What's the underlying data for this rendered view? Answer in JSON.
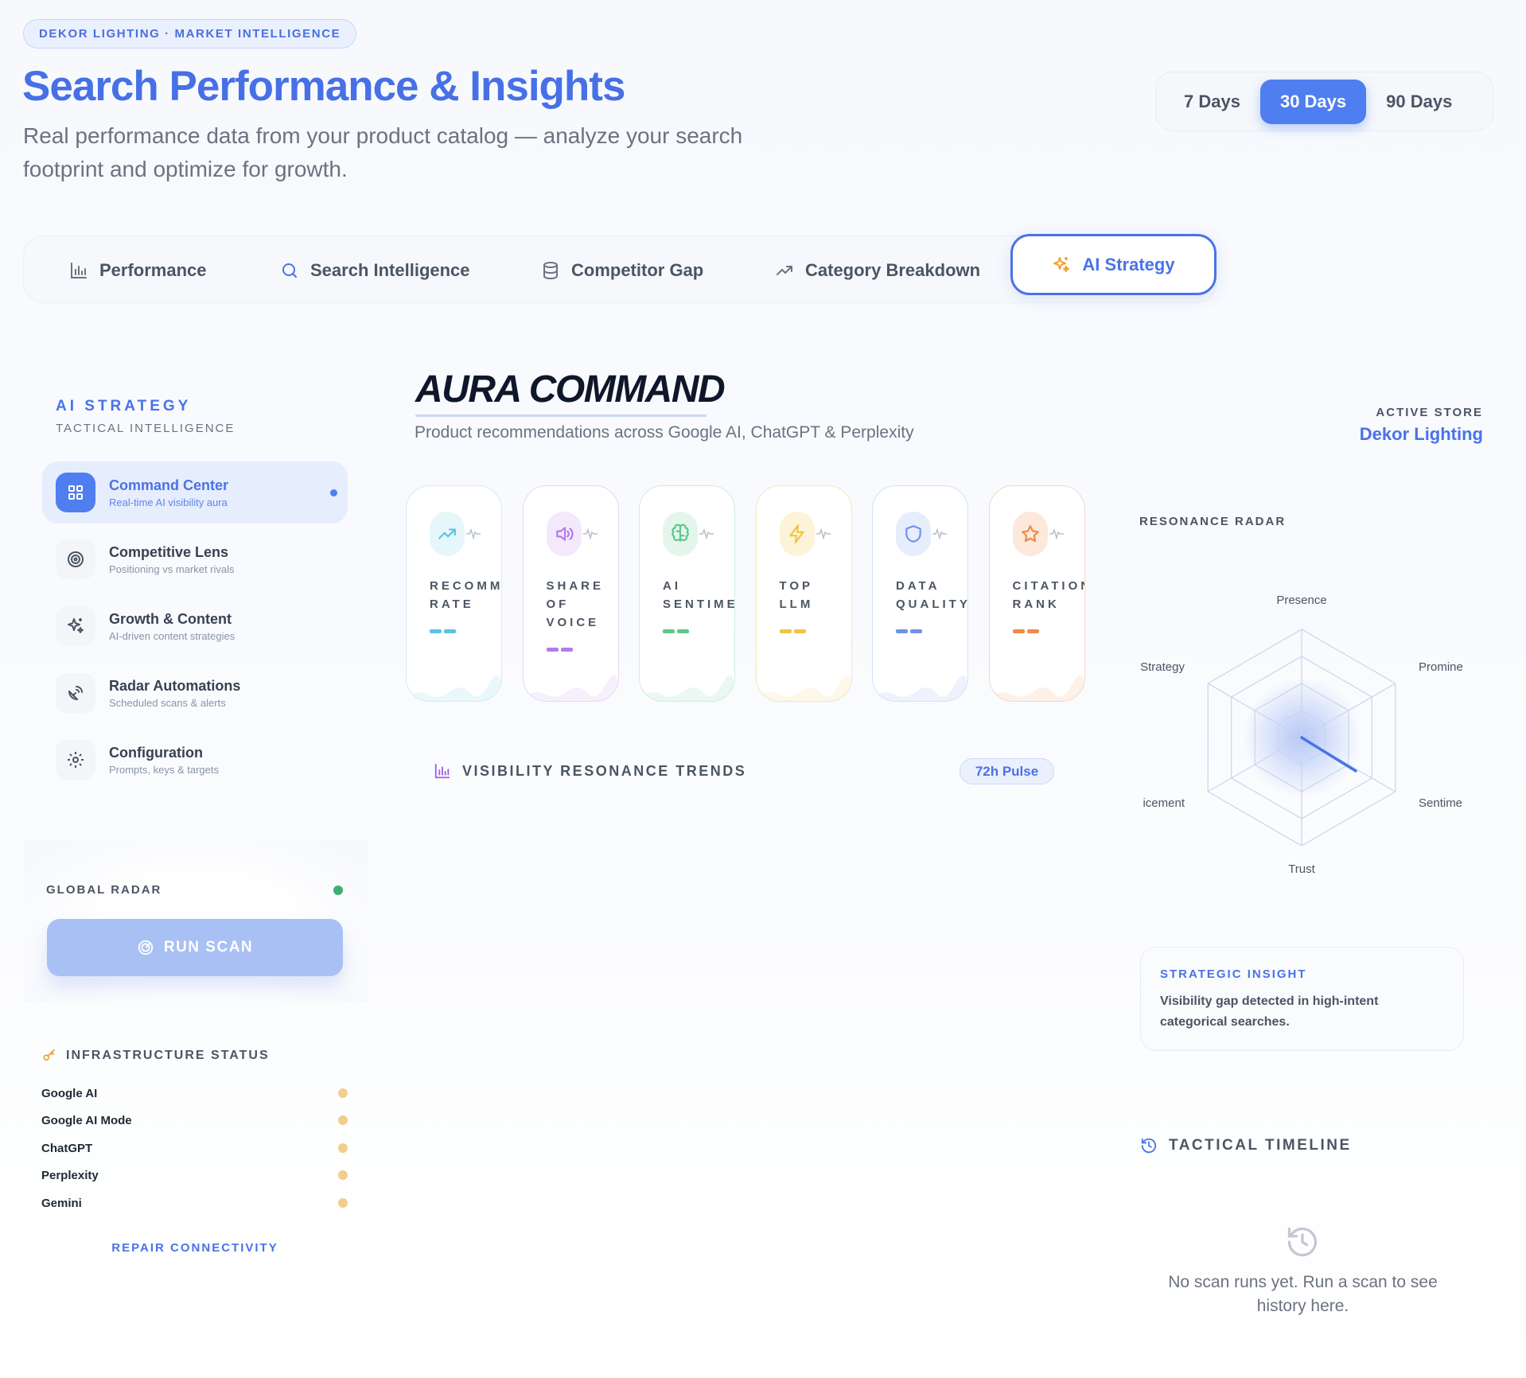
{
  "header": {
    "tag": "DEKOR LIGHTING · MARKET INTELLIGENCE",
    "title": "Search Performance & Insights",
    "subtitle": "Real performance data from your product catalog — analyze your search footprint and optimize for growth."
  },
  "date_range": {
    "options": [
      "7 Days",
      "30 Days",
      "90 Days"
    ],
    "selected": "30 Days"
  },
  "tabs": [
    {
      "label": "Performance",
      "icon": "bar-chart-icon"
    },
    {
      "label": "Search Intelligence",
      "icon": "search-icon"
    },
    {
      "label": "Competitor Gap",
      "icon": "database-icon"
    },
    {
      "label": "Category Breakdown",
      "icon": "trending-up-icon"
    },
    {
      "label": "AI Strategy",
      "icon": "sparkles-icon",
      "active": true
    }
  ],
  "sidebar": {
    "title": "AI STRATEGY",
    "subtitle": "TACTICAL INTELLIGENCE",
    "items": [
      {
        "label": "Command Center",
        "desc": "Real-time AI visibility aura",
        "icon": "grid-icon",
        "active": true
      },
      {
        "label": "Competitive Lens",
        "desc": "Positioning vs market rivals",
        "icon": "target-icon"
      },
      {
        "label": "Growth & Content",
        "desc": "AI-driven content strategies",
        "icon": "sparkles-icon"
      },
      {
        "label": "Radar Automations",
        "desc": "Scheduled scans & alerts",
        "icon": "satellite-dish-icon"
      },
      {
        "label": "Configuration",
        "desc": "Prompts, keys & targets",
        "icon": "gear-icon"
      }
    ],
    "global_radar": {
      "label": "GLOBAL RADAR",
      "status_color": "#3fae6f",
      "button": "RUN SCAN"
    },
    "infrastructure": {
      "title": "INFRASTRUCTURE STATUS",
      "providers": [
        "Google AI",
        "Google AI Mode",
        "ChatGPT",
        "Perplexity",
        "Gemini"
      ],
      "status_color": "#f3cd8e",
      "repair_label": "REPAIR CONNECTIVITY"
    }
  },
  "main": {
    "title": "AURA COMMAND",
    "subtitle": "Product recommendations across Google AI, ChatGPT & Perplexity",
    "kpis": [
      {
        "label": "RECOMMI\nRATE",
        "value": "——",
        "color": "#5bc2e2",
        "icon": "trending-up-icon"
      },
      {
        "label": "SHARE\nOF\nVOICE",
        "value": "——",
        "color": "#b57be8",
        "icon": "speaker-icon"
      },
      {
        "label": "AI\nSENTIME",
        "value": "——",
        "color": "#5cc88b",
        "icon": "brain-icon"
      },
      {
        "label": "TOP\nLLM",
        "value": "——",
        "color": "#f0c445",
        "icon": "lightning-icon"
      },
      {
        "label": "DATA\nQUALITY",
        "value": "——",
        "color": "#6f92e8",
        "icon": "shield-icon"
      },
      {
        "label": "CITATION\nRANK",
        "value": "——",
        "color": "#ee8a4a",
        "icon": "star-icon"
      }
    ],
    "trends": {
      "title": "VISIBILITY RESONANCE TRENDS",
      "badge": "72h Pulse"
    }
  },
  "right": {
    "active_store_label": "ACTIVE STORE",
    "active_store": "Dekor Lighting",
    "radar_title": "RESONANCE RADAR",
    "radar_axes": [
      "Presence",
      "Promine",
      "Sentime",
      "Trust",
      "icement",
      "Strategy"
    ],
    "insight": {
      "title": "STRATEGIC INSIGHT",
      "text": "Visibility gap detected in high-intent categorical searches."
    },
    "timeline": {
      "title": "TACTICAL TIMELINE",
      "empty": "No scan runs yet. Run a scan to see history here."
    }
  }
}
